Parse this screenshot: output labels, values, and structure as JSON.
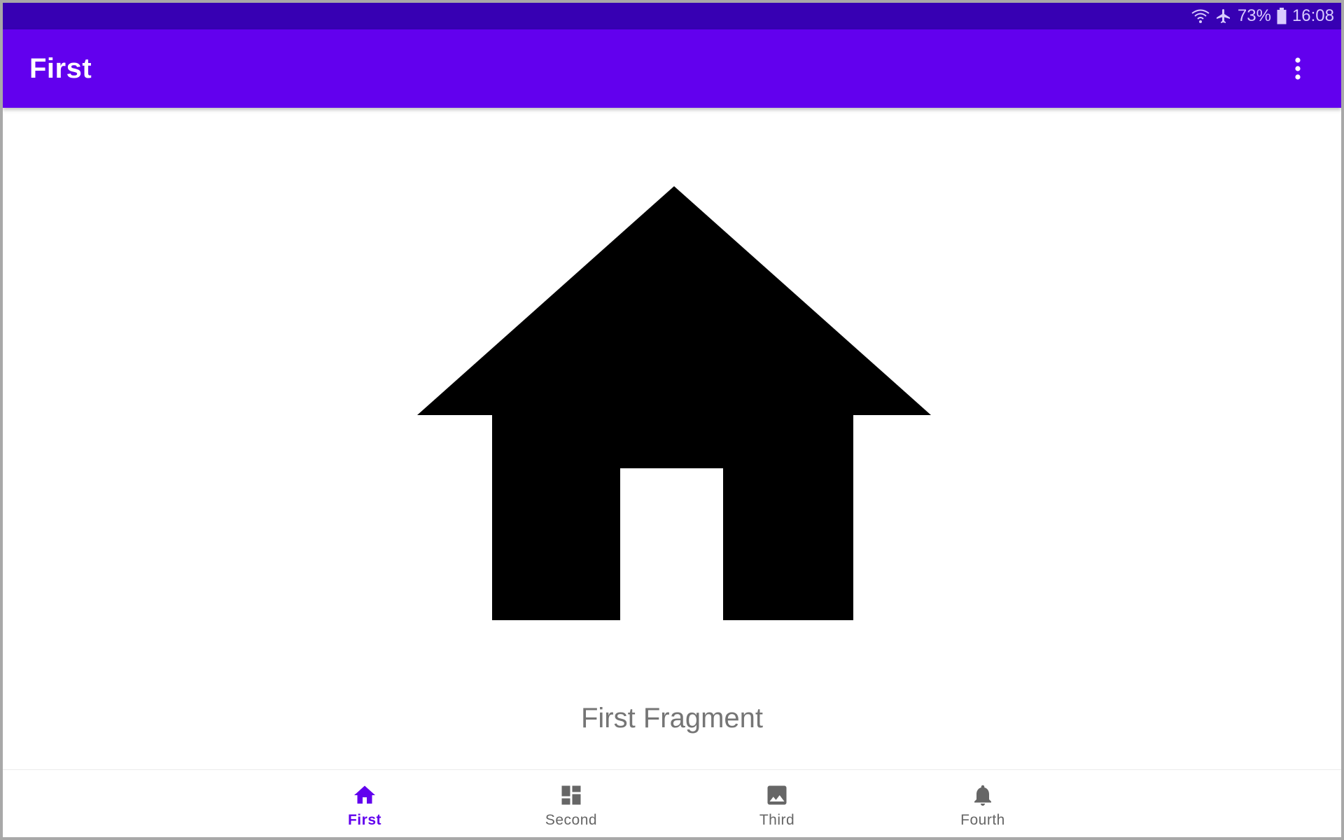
{
  "status_bar": {
    "battery_percent": "73%",
    "time": "16:08",
    "icons": [
      "wifi-icon",
      "airplane-mode-icon",
      "battery-icon"
    ]
  },
  "app_bar": {
    "title": "First",
    "overflow_icon": "more-vert-icon"
  },
  "content": {
    "hero_icon": "home-icon",
    "label": "First Fragment"
  },
  "bottom_nav": {
    "items": [
      {
        "label": "First",
        "icon": "home-icon",
        "selected": true
      },
      {
        "label": "Second",
        "icon": "dashboard-icon",
        "selected": false
      },
      {
        "label": "Third",
        "icon": "image-icon",
        "selected": false
      },
      {
        "label": "Fourth",
        "icon": "notifications-icon",
        "selected": false
      }
    ]
  },
  "colors": {
    "primary": "#6200ee",
    "primary_dark": "#3700b3",
    "on_primary": "#ffffff",
    "inactive": "#666666",
    "label_gray": "#757575"
  }
}
